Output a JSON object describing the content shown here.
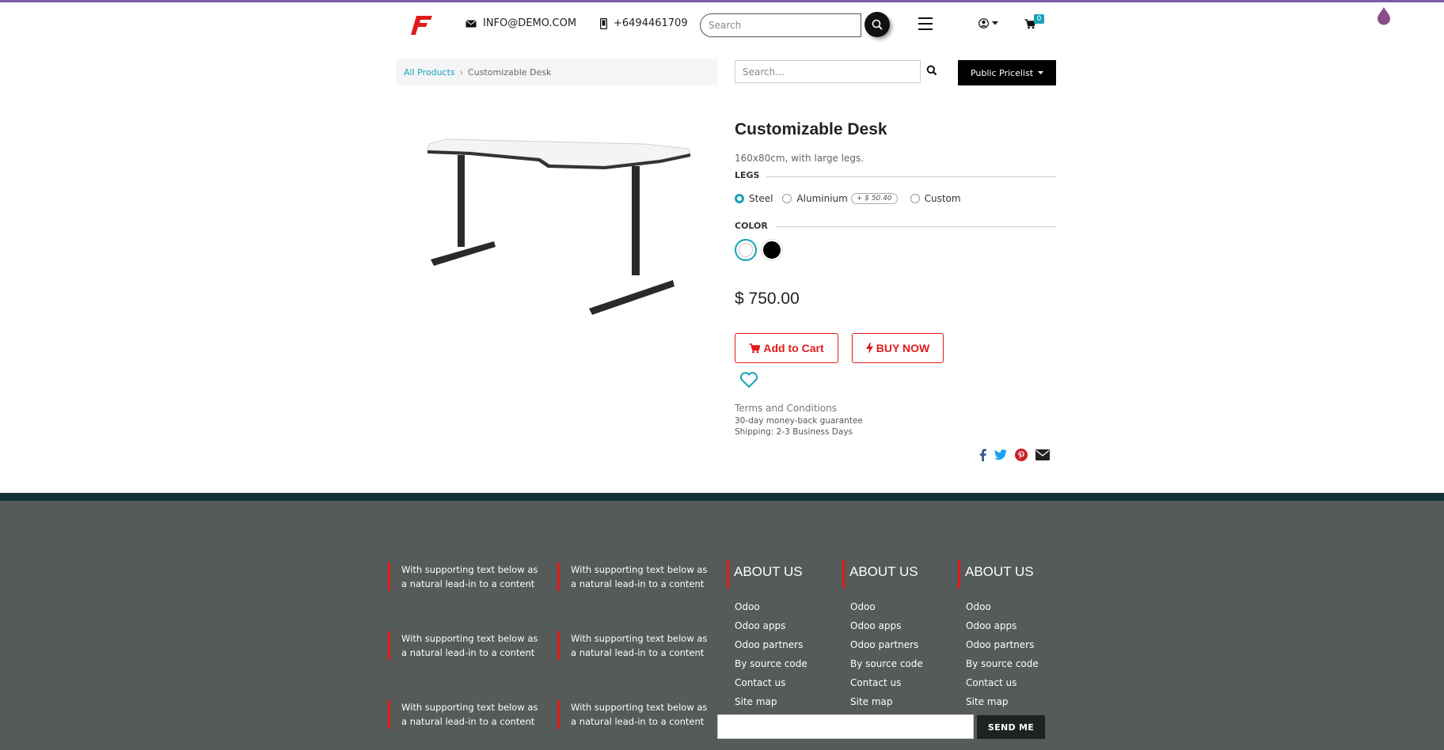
{
  "header": {
    "email": "INFO@DEMO.COM",
    "phone": "+6494461709",
    "search_placeholder": "Search",
    "cart_count": "0",
    "icons": [
      "logo-icon",
      "envelope-icon",
      "mobile-icon",
      "search-icon",
      "hamburger-icon",
      "user-icon",
      "cart-icon",
      "drop-icon"
    ]
  },
  "breadcrumb": {
    "parent": "All Products",
    "separator": "›",
    "current": "Customizable Desk"
  },
  "subheader": {
    "search_placeholder": "Search...",
    "pricelist_label": "Public Pricelist"
  },
  "product": {
    "title": "Customizable Desk",
    "description": "160x80cm, with large legs.",
    "legs_label": "LEGS",
    "legs_options": [
      {
        "label": "Steel",
        "selected": true
      },
      {
        "label": "Aluminium",
        "extra": "+ $ 50.40",
        "selected": false
      },
      {
        "label": "Custom",
        "selected": false
      }
    ],
    "color_label": "COLOR",
    "colors": [
      {
        "name": "White",
        "hex": "#ffffff",
        "selected": true
      },
      {
        "name": "Black",
        "hex": "#000000",
        "selected": false
      }
    ],
    "price": "$ 750.00",
    "add_to_cart_label": "Add to Cart",
    "buy_now_label": "BUY NOW",
    "terms_label": "Terms and Conditions",
    "guarantee": "30-day money-back guarantee",
    "shipping": "Shipping: 2-3 Business Days"
  },
  "footer": {
    "feature_text_line1": "With supporting text below as",
    "feature_text_line2": "a natural lead-in to a content",
    "about_title": "ABOUT US",
    "about_links": [
      "Odoo",
      "Odoo apps",
      "Odoo partners",
      "By source code",
      "Contact us",
      "Site map"
    ],
    "send_label": "SEND ME"
  },
  "colors": {
    "accent": "#17a2b8",
    "cta_red": "#e01b1b",
    "footer_bg": "#555a5a",
    "top_line": "#7b5ea7"
  }
}
